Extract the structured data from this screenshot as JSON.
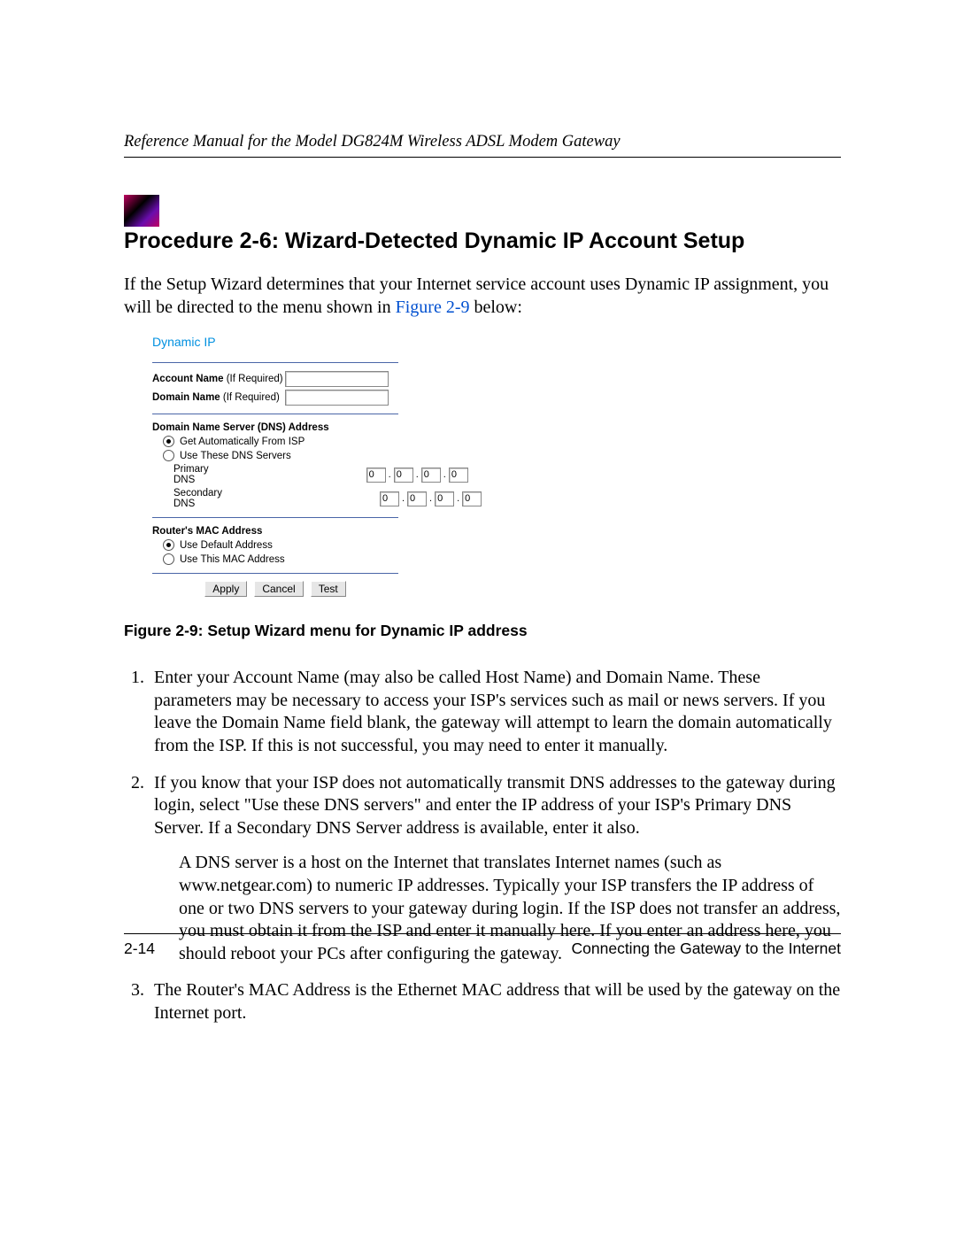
{
  "header": "Reference Manual for the Model DG824M Wireless ADSL Modem Gateway",
  "procedure_title": "Procedure 2-6:  Wizard-Detected Dynamic IP Account Setup",
  "intro_text_before_link": "If the Setup Wizard determines that your Internet service account uses Dynamic IP assignment, you will be directed to the menu shown in ",
  "intro_link": "Figure 2-9",
  "intro_text_after_link": " below:",
  "figure": {
    "screen_title": "Dynamic IP",
    "account_name_label": "Account Name",
    "account_name_req": " (If Required)",
    "account_name_value": "",
    "domain_name_label": "Domain Name",
    "domain_name_req": " (If Required)",
    "domain_name_value": "",
    "dns_section_label": "Domain Name Server (DNS) Address",
    "dns_auto_label": "Get Automatically From ISP",
    "dns_use_label": "Use These DNS Servers",
    "primary_dns_label": "Primary DNS",
    "secondary_dns_label": "Secondary DNS",
    "ip_zero": "0",
    "mac_section_label": "Router's MAC Address",
    "mac_default_label": "Use Default Address",
    "mac_use_label": "Use This MAC Address",
    "btn_apply": "Apply",
    "btn_cancel": "Cancel",
    "btn_test": "Test"
  },
  "figure_caption": "Figure 2-9: Setup Wizard menu for Dynamic IP address",
  "steps": {
    "s1": "Enter your Account Name (may also be called Host Name) and Domain Name. These parameters may be necessary to access your ISP's services such as mail or news servers. If you leave the Domain Name field blank, the gateway will attempt to learn the domain automatically from the ISP. If this is not successful, you may need to enter it manually.",
    "s2": "If you know that your ISP does not automatically transmit DNS addresses to the gateway during login, select \"Use these DNS servers\" and enter the IP address of your ISP's Primary DNS Server. If a Secondary DNS Server address is available, enter it also.",
    "s2_sub": "A DNS server is a host on the Internet that translates Internet names (such as www.netgear.com) to numeric IP addresses. Typically your ISP transfers the IP address of one or two DNS servers to your gateway during login. If the ISP does not transfer an address, you must obtain it from the ISP and enter it manually here. If you enter an address here, you should reboot your PCs after configuring the gateway.",
    "s3": "The Router's MAC Address is the Ethernet MAC address that will be used by the gateway on the Internet port."
  },
  "footer": {
    "left": "2-14",
    "right": "Connecting the Gateway to the Internet"
  }
}
